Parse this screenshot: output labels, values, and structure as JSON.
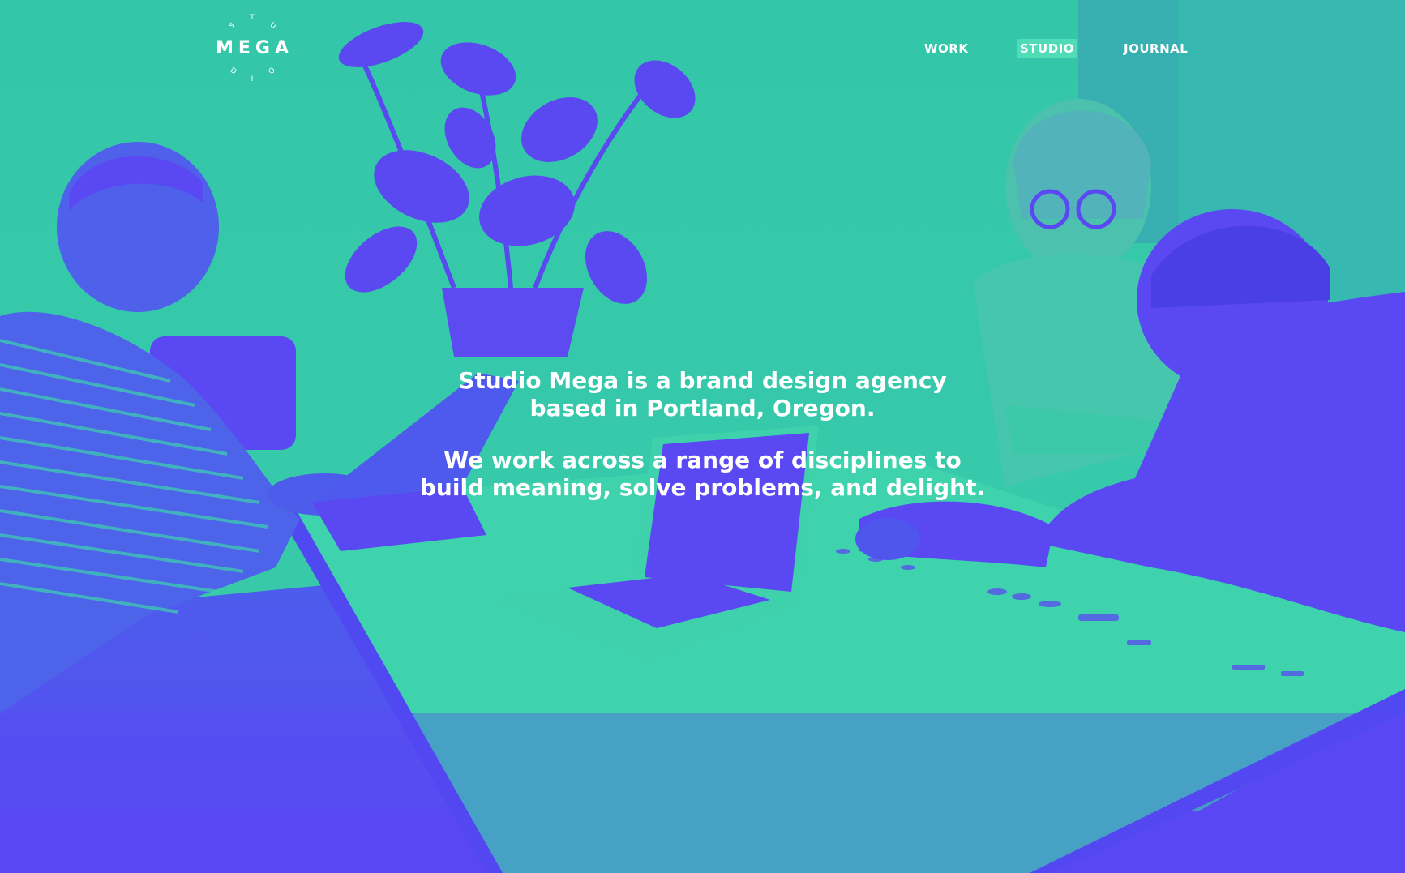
{
  "colors": {
    "brand_teal": "#36c5a9",
    "brand_violet": "#5a4cf2",
    "nav_active_bg": "#4fdcb6",
    "text": "#ffffff"
  },
  "logo": {
    "word": "MEGA",
    "ring_letters": [
      "S",
      "T",
      "U",
      "D",
      "I",
      "O"
    ]
  },
  "nav": {
    "items": [
      {
        "label": "WORK",
        "active": false
      },
      {
        "label": "STUDIO",
        "active": true
      },
      {
        "label": "JOURNAL",
        "active": false
      }
    ]
  },
  "intro": {
    "line1": "Studio Mega is a brand design agency",
    "line2": "based in Portland, Oregon.",
    "line3": "We work across a range of disciplines to",
    "line4": "build meaning, solve problems, and delight."
  },
  "hero_image": {
    "icons": [
      "person-icon",
      "plant-icon",
      "laptop-icon"
    ]
  }
}
